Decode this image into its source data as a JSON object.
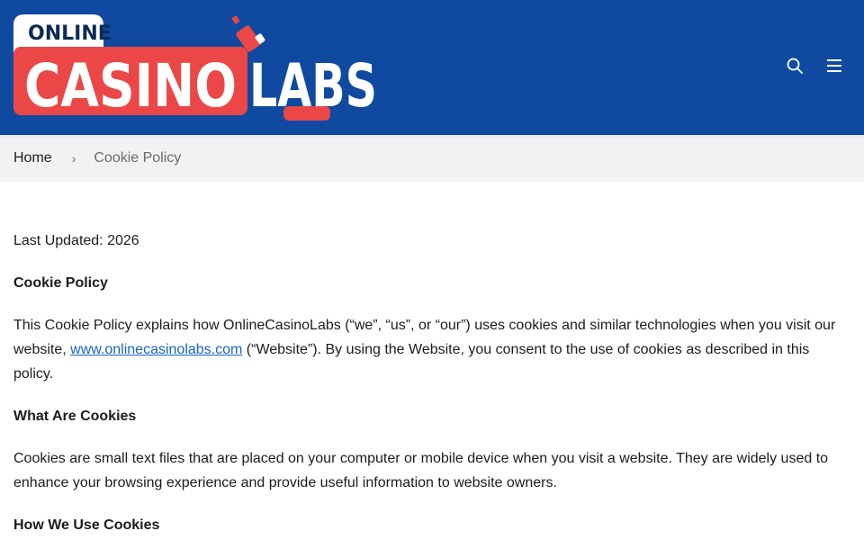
{
  "header": {
    "logo": {
      "line1": "ONLINE",
      "word_casino": "CASINO",
      "word_labs": "LABS",
      "colors": {
        "red": "#ec4747",
        "navy": "#0f4aa0",
        "white": "#ffffff",
        "dark": "#0b2a55"
      }
    },
    "icons": [
      "search-icon",
      "menu-icon"
    ]
  },
  "breadcrumb": {
    "home": "Home",
    "separator": "›",
    "current": "Cookie Policy"
  },
  "content": {
    "last_updated": "Last Updated: 2026",
    "title": "Cookie Policy",
    "intro_before_link": "This Cookie Policy explains how OnlineCasinoLabs (“we”, “us”, or “our”) uses cookies and similar technologies when you visit our website, ",
    "intro_link": "www.onlinecasinolabs.com",
    "intro_after_link": " (“Website”). By using the Website, you consent to the use of cookies as described in this policy.",
    "section1_heading": "What Are Cookies",
    "section1_body": "Cookies are small text files that are placed on your computer or mobile device when you visit a website. They are widely used to enhance your browsing experience and provide useful information to website owners.",
    "section2_heading": "How We Use Cookies"
  }
}
